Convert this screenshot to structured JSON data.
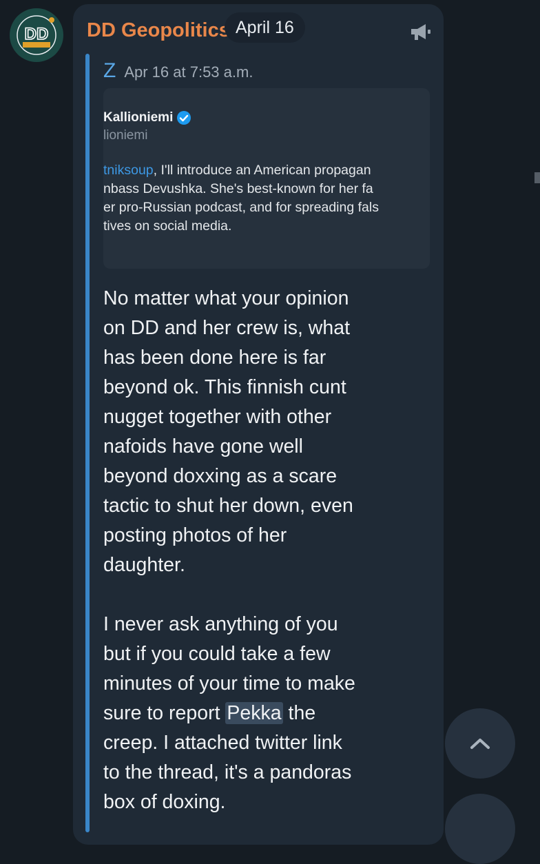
{
  "channel": {
    "name": "DD Geopolitics",
    "avatar_icon": "dd-geopolitics-logo"
  },
  "date_pill": "April 16",
  "header_icon": "megaphone-icon",
  "forward": {
    "author": "Z",
    "time": "Apr 16 at 7:53 a.m."
  },
  "tweet_card": {
    "name": "Kallioniemi",
    "verified_icon": "verified-badge-icon",
    "handle": "lioniemi",
    "lines": [
      {
        "link": "tniksoup",
        "text": ", I'll introduce an American propagan"
      },
      {
        "link": "",
        "text": "nbass Devushka. She's best-known for her fa"
      },
      {
        "link": "",
        "text": "er pro-Russian podcast, and for spreading fals"
      },
      {
        "link": "",
        "text": "tives on social media."
      }
    ]
  },
  "message": {
    "lines": [
      "No matter what your opinion",
      "on DD and her crew is, what",
      "has been done here is far",
      "beyond ok. This finnish cunt",
      "nugget together with other",
      "nafoids have gone well",
      "beyond doxxing as a scare",
      "tactic to shut her down, even",
      "posting photos of her",
      "daughter.",
      "",
      "I never ask anything of you",
      "but if you could take a few",
      "minutes of your time to make"
    ],
    "highlight_line": {
      "before": "sure to report ",
      "highlight": "Pekka",
      "after": " the"
    },
    "tail_lines": [
      "creep. I attached twitter link",
      "to the thread, it's a pandoras",
      "box of doxing."
    ]
  },
  "scroll_button_icon": "chevron-up-icon",
  "colors": {
    "background": "#151c23",
    "bubble": "#1f2a36",
    "channel_name": "#e9874a",
    "accent_blue": "#3a86c8",
    "link": "#3d98e4"
  }
}
